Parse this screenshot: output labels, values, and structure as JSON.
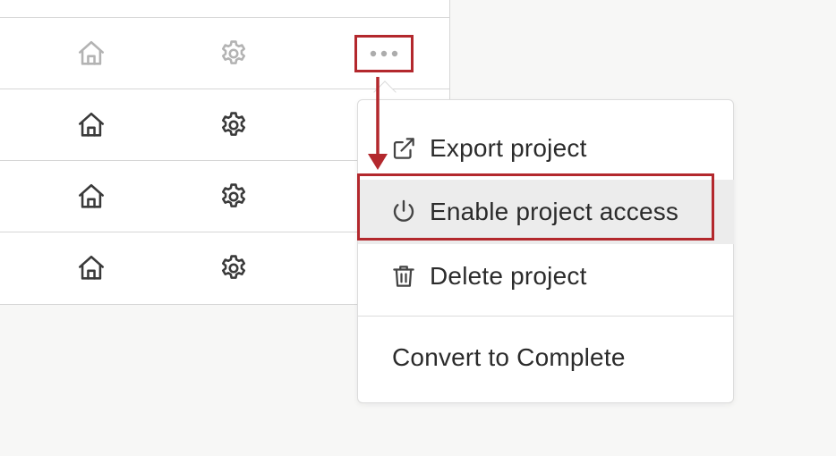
{
  "table": {
    "rows": [
      {
        "home_icon": "home-icon",
        "settings_icon": "gear-icon",
        "has_more": true,
        "muted": true
      },
      {
        "home_icon": "home-icon",
        "settings_icon": "gear-icon",
        "has_more": false,
        "muted": false
      },
      {
        "home_icon": "home-icon",
        "settings_icon": "gear-icon",
        "has_more": false,
        "muted": false
      },
      {
        "home_icon": "home-icon",
        "settings_icon": "gear-icon",
        "has_more": false,
        "muted": false
      }
    ]
  },
  "menu": {
    "items": [
      {
        "label": "Export project",
        "icon": "external-link-icon"
      },
      {
        "label": "Enable project access",
        "icon": "power-icon",
        "highlighted": true
      },
      {
        "label": "Delete project",
        "icon": "trash-icon"
      },
      {
        "label": "Convert to Complete"
      }
    ]
  },
  "colors": {
    "annotation": "#b3282d",
    "icon": "#4a4a4a",
    "highlight_bg": "#ececec"
  }
}
